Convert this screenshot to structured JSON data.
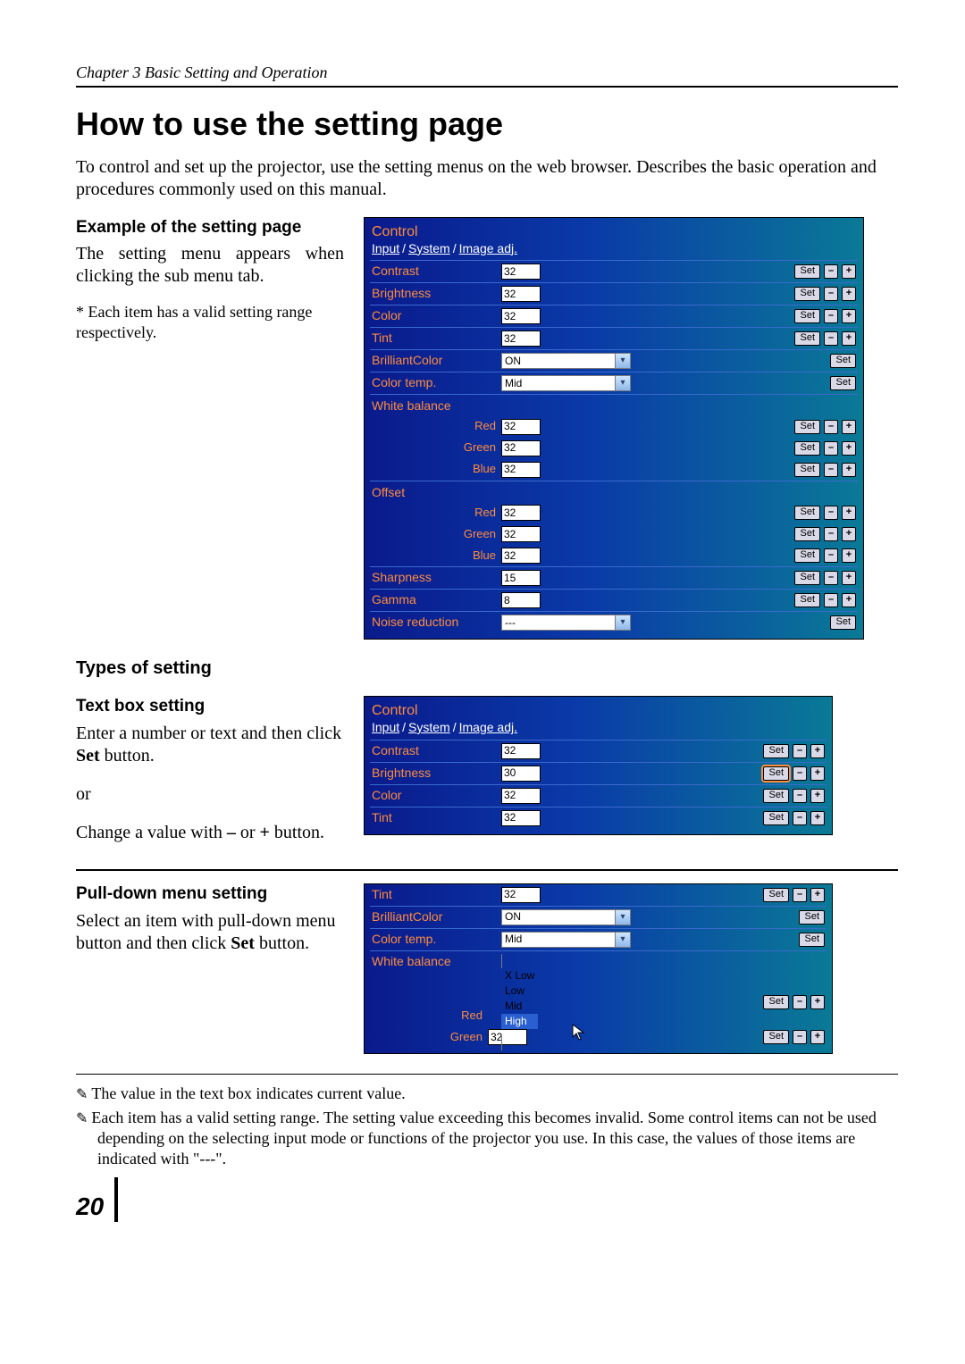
{
  "chapter_header": "Chapter 3 Basic Setting and Operation",
  "page_title": "How to use the setting page",
  "intro": "To control and set up the projector, use the setting menus on the web browser. Describes the basic operation and procedures commonly used on this manual.",
  "example_heading": "Example of the setting page",
  "example_para": "The setting menu appears when clicking the sub menu tab.",
  "example_note": "* Each item has a valid setting range respectively.",
  "types_heading": "Types of setting",
  "textbox_heading": "Text box setting",
  "textbox_para1a": "Enter a number or text and then click ",
  "textbox_para1b": "Set",
  "textbox_para1c": " button.",
  "textbox_or": "or",
  "textbox_para2a": "Change a value with ",
  "textbox_para2b": "–",
  "textbox_para2c": " or ",
  "textbox_para2d": "+",
  "textbox_para2e": " button.",
  "pulldown_heading": "Pull-down menu setting",
  "pulldown_para_a": "Select an item with pull-down menu button and then click ",
  "pulldown_para_b": "Set",
  "pulldown_para_c": " button.",
  "footnote1": "The value in the text box indicates current value.",
  "footnote2": "Each item has a valid setting range. The setting value exceeding this becomes invalid. Some control items can not be used depending on the selecting input mode or functions of the projector you use. In this case, the values of those items are indicated with \"---\".",
  "page_number": "20",
  "panel": {
    "title": "Control",
    "bc1": "Input",
    "bc2": "System",
    "bc3": "Image adj.",
    "set": "Set",
    "minus": "–",
    "plus": "+",
    "dd_caret": "▾"
  },
  "fig1": {
    "contrast": {
      "label": "Contrast",
      "value": "32"
    },
    "brightness": {
      "label": "Brightness",
      "value": "32"
    },
    "color": {
      "label": "Color",
      "value": "32"
    },
    "tint": {
      "label": "Tint",
      "value": "32"
    },
    "brilliant": {
      "label": "BrilliantColor",
      "value": "ON"
    },
    "colortemp": {
      "label": "Color temp.",
      "value": "Mid"
    },
    "whitebalance": {
      "label": "White balance",
      "red": {
        "label": "Red",
        "value": "32"
      },
      "green": {
        "label": "Green",
        "value": "32"
      },
      "blue": {
        "label": "Blue",
        "value": "32"
      }
    },
    "offset": {
      "label": "Offset",
      "red": {
        "label": "Red",
        "value": "32"
      },
      "green": {
        "label": "Green",
        "value": "32"
      },
      "blue": {
        "label": "Blue",
        "value": "32"
      }
    },
    "sharpness": {
      "label": "Sharpness",
      "value": "15"
    },
    "gamma": {
      "label": "Gamma",
      "value": "8"
    },
    "noise": {
      "label": "Noise reduction",
      "value": "---"
    }
  },
  "fig2": {
    "contrast": {
      "label": "Contrast",
      "value": "32"
    },
    "brightness": {
      "label": "Brightness",
      "value": "30"
    },
    "color": {
      "label": "Color",
      "value": "32"
    },
    "tint": {
      "label": "Tint",
      "value": "32"
    }
  },
  "fig3": {
    "tint": {
      "label": "Tint",
      "value": "32"
    },
    "brilliant": {
      "label": "BrilliantColor",
      "value": "ON"
    },
    "colortemp": {
      "label": "Color temp.",
      "value": "Mid",
      "options": [
        "X Low",
        "Low",
        "Mid",
        "High"
      ],
      "selected": "High"
    },
    "whitebalance": {
      "label": "White balance",
      "red": {
        "label": "Red"
      },
      "green": {
        "label": "Green",
        "value": "32"
      }
    }
  }
}
